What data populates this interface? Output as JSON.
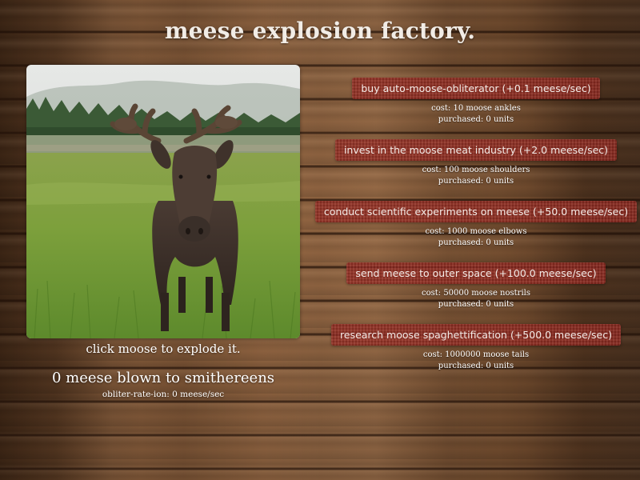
{
  "title": "meese explosion factory.",
  "moose_image": {
    "alt": "moose",
    "icon": "moose-photo"
  },
  "click_hint": "click moose to explode it.",
  "counter": "0 meese blown to smithereens",
  "rate": "obliter-rate-ion: 0 meese/sec",
  "colors": {
    "button_red": "#962820",
    "text": "#ffffff",
    "wood": "#7a5233"
  },
  "upgrades": [
    {
      "label": "buy auto-moose-obliterator (+0.1 meese/sec)",
      "cost": "cost: 10 moose ankles",
      "purchased": "purchased: 0 units"
    },
    {
      "label": "invest in the moose meat industry (+2.0 meese/sec)",
      "cost": "cost: 100 moose shoulders",
      "purchased": "purchased: 0 units"
    },
    {
      "label": "conduct scientific experiments on meese (+50.0 meese/sec)",
      "cost": "cost: 1000 moose elbows",
      "purchased": "purchased: 0 units"
    },
    {
      "label": "send meese to outer space (+100.0 meese/sec)",
      "cost": "cost: 50000 moose nostrils",
      "purchased": "purchased: 0 units"
    },
    {
      "label": "research moose spaghettification (+500.0 meese/sec)",
      "cost": "cost: 1000000 moose tails",
      "purchased": "purchased: 0 units"
    }
  ]
}
